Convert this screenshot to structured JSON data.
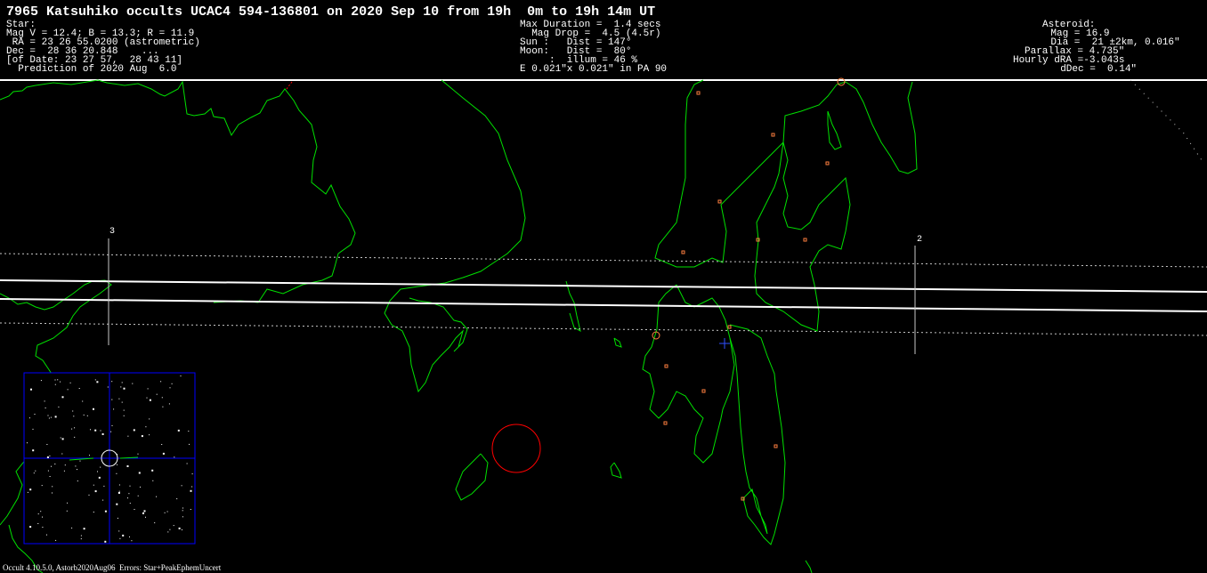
{
  "header": {
    "title": "7965 Katsuhiko occults UCAC4 594-136801 on 2020 Sep 10 from 19h  0m to 19h 14m UT"
  },
  "star_block": {
    "lines": [
      "Star:",
      "Mag V = 12.4; B = 13.3; R = 11.9",
      " RA = 23 26 55.0200 (astrometric)",
      "Dec =  28 36 20.848    ...",
      "[of Date: 23 27 57,  28 43 11]",
      "  Prediction of 2020 Aug  6.0"
    ]
  },
  "event_block": {
    "lines": [
      "Max Duration =  1.4 secs",
      "  Mag Drop =  4.5 (4.5r)",
      "Sun :   Dist = 147°",
      "Moon:   Dist =  80°",
      "     :  illum = 46 %",
      "E 0.021\"x 0.021\" in PA 90"
    ]
  },
  "asteroid_block": {
    "lines": [
      "Asteroid:",
      "    Mag = 16.9",
      "    Dia =  21 ±2km, 0.016\"",
      "Parallax = 4.735\"",
      "Hourly dRA =-3.043s",
      "  dDec =  0.14\""
    ]
  },
  "map": {
    "background_color": "#000000",
    "coastline_color": "#00e000",
    "path_color": "#ffffff",
    "uncertainty_color": "#c8c8c8",
    "city_color": "#ff8040",
    "shadow_circle_color": "#ff0000",
    "center_cross_color": "#3050ff",
    "starfield_frame_color": "#0000ff",
    "time_markers": [
      "3",
      "2"
    ]
  },
  "footer": {
    "text": "Occult 4.10.5.0, Astorb2020Aug06  Errors: Star+PeakEphemUncert"
  }
}
